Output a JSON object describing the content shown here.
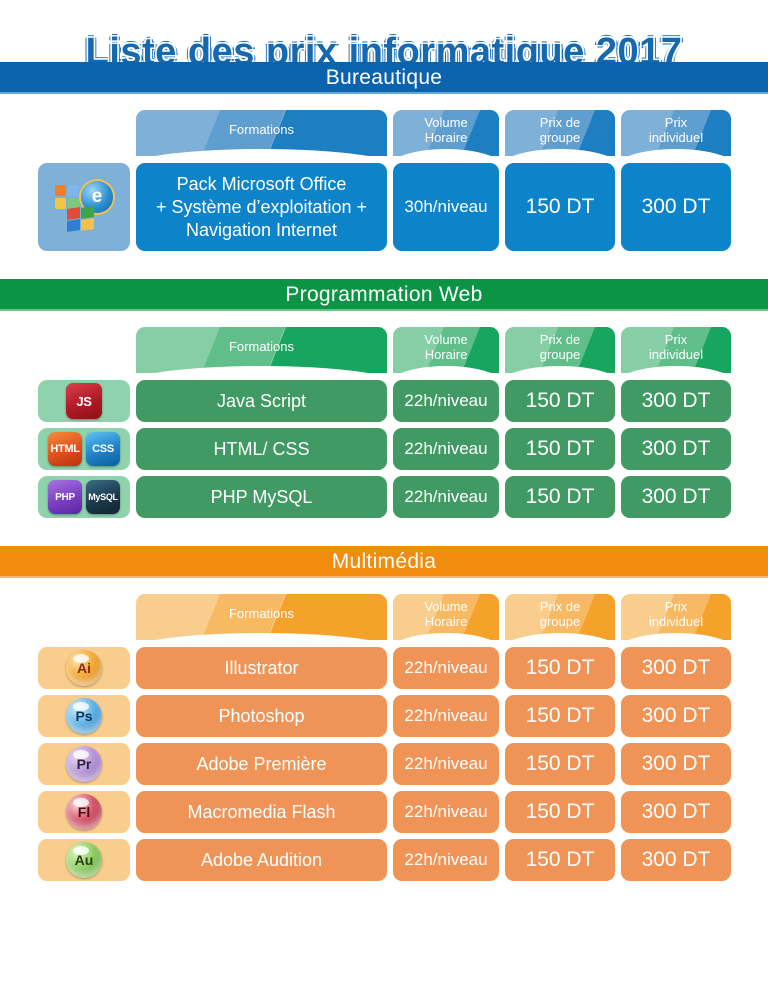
{
  "title": "Liste des prix informatique 2017",
  "colors": {
    "blue_band": "#0a63ac",
    "green_band": "#0b9444",
    "orange_band": "#f18c0e",
    "blue_row": "#0d83c9",
    "green_row": "#419a63",
    "orange_row": "#ef9456"
  },
  "columns": {
    "formations": "Formations",
    "volume_horaire_line1": "Volume",
    "volume_horaire_line2": "Horaire",
    "prix_groupe_line1": "Prix de",
    "prix_groupe_line2": "groupe",
    "prix_individuel_line1": "Prix",
    "prix_individuel_line2": "individuel"
  },
  "sections": [
    {
      "name": "Bureautique",
      "theme": "blue",
      "rows": [
        {
          "icon": "microsoft-office-internet-explorer-windows-icon",
          "formation_line1": "Pack Microsoft Office",
          "formation_line2": "+ Système d’exploitation +",
          "formation_line3": "Navigation Internet",
          "volume": "30h/niveau",
          "prix_groupe": "150 DT",
          "prix_individuel": "300 DT"
        }
      ]
    },
    {
      "name": "Programmation Web",
      "theme": "green",
      "rows": [
        {
          "icon": "javascript-icon",
          "badges": [
            "JS"
          ],
          "formation": "Java Script",
          "volume": "22h/niveau",
          "prix_groupe": "150 DT",
          "prix_individuel": "300 DT"
        },
        {
          "icon": "html-css-icon",
          "badges": [
            "HTML",
            "CSS"
          ],
          "formation": "HTML/ CSS",
          "volume": "22h/niveau",
          "prix_groupe": "150 DT",
          "prix_individuel": "300 DT"
        },
        {
          "icon": "php-mysql-icon",
          "badges": [
            "PHP",
            "MySQL"
          ],
          "formation": "PHP MySQL",
          "volume": "22h/niveau",
          "prix_groupe": "150 DT",
          "prix_individuel": "300 DT"
        }
      ]
    },
    {
      "name": "Multimédia",
      "theme": "orange",
      "rows": [
        {
          "icon": "adobe-illustrator-icon",
          "glyph": "Ai",
          "formation": "Illustrator",
          "volume": "22h/niveau",
          "prix_groupe": "150 DT",
          "prix_individuel": "300 DT"
        },
        {
          "icon": "adobe-photoshop-icon",
          "glyph": "Ps",
          "formation": "Photoshop",
          "volume": "22h/niveau",
          "prix_groupe": "150 DT",
          "prix_individuel": "300 DT"
        },
        {
          "icon": "adobe-premiere-icon",
          "glyph": "Pr",
          "formation": "Adobe Première",
          "volume": "22h/niveau",
          "prix_groupe": "150 DT",
          "prix_individuel": "300 DT"
        },
        {
          "icon": "macromedia-flash-icon",
          "glyph": "Fl",
          "formation": "Macromedia Flash",
          "volume": "22h/niveau",
          "prix_groupe": "150 DT",
          "prix_individuel": "300 DT"
        },
        {
          "icon": "adobe-audition-icon",
          "glyph": "Au",
          "formation": "Adobe Audition",
          "volume": "22h/niveau",
          "prix_groupe": "150 DT",
          "prix_individuel": "300 DT"
        }
      ]
    }
  ]
}
